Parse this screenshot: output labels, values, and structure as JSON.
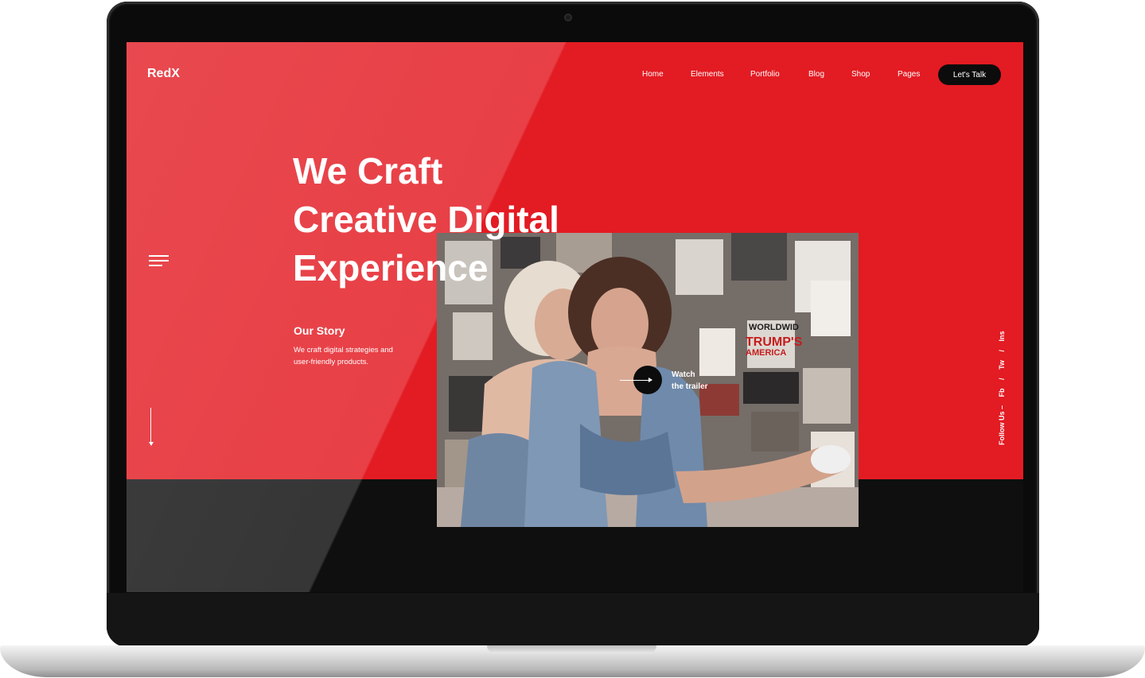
{
  "brand": {
    "logo": "RedX"
  },
  "nav": {
    "items": [
      "Home",
      "Elements",
      "Portfolio",
      "Blog",
      "Shop",
      "Pages"
    ],
    "cta": "Let's Talk"
  },
  "hero": {
    "headline": [
      "We Craft",
      "Creative Digital",
      "Experience"
    ]
  },
  "story": {
    "title": "Our Story",
    "text": "We craft digital strategies and user-friendly products."
  },
  "trailer": {
    "label_line1": "Watch",
    "label_line2": "the trailer"
  },
  "social": {
    "prefix": "Follow Us –",
    "links": [
      "Fb",
      "Tw",
      "Ins"
    ],
    "separator": "/"
  },
  "colors": {
    "accent": "#e31b23",
    "dark": "#0f0f0f",
    "button": "#0c0c0c"
  },
  "icons": [
    "menu-icon",
    "down-arrow-icon",
    "right-arrow-icon",
    "camera-icon"
  ]
}
